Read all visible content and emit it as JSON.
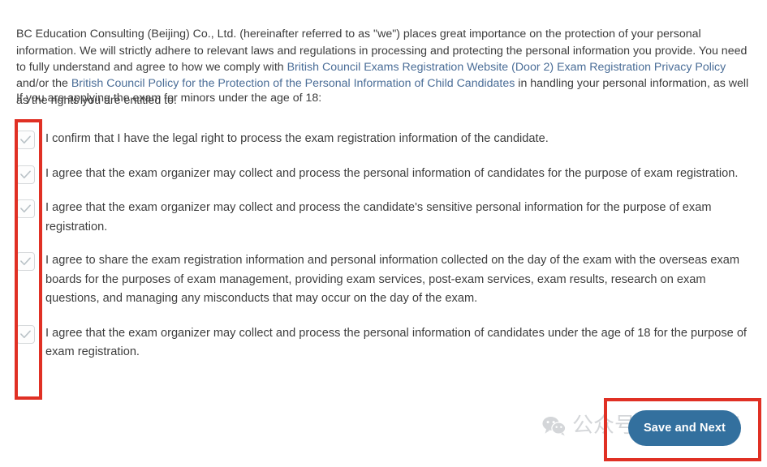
{
  "intro": {
    "part1": "BC Education Consulting (Beijing) Co., Ltd. (hereinafter referred to as \"we\") places great importance on the protection of your personal information. We will strictly adhere to relevant laws and regulations in processing and protecting the personal information you provide. You need to fully understand and agree to how we comply with ",
    "link1": "British Council Exams Registration Website (Door 2) Exam Registration Privacy Policy",
    "part2": " and/or the ",
    "link2": "British Council Policy for the Protection of the Personal Information of Child Candidates",
    "part3": " in handling your personal information, as well as the rights you are entitled to."
  },
  "minors_notice": "If you are applying the exam for minors under the age of 18:",
  "consents": [
    {
      "checked": true,
      "text": "I confirm that I have the legal right to process the exam registration information of the candidate."
    },
    {
      "checked": true,
      "text": "I agree that the exam organizer may collect and process the personal information of candidates for the purpose of exam registration."
    },
    {
      "checked": true,
      "text": "I agree that the exam organizer may collect and process the candidate's sensitive personal information for the purpose of exam registration."
    },
    {
      "checked": true,
      "text": "I agree to share the exam registration information and personal information collected on the day of the exam with the overseas exam boards for the purposes of exam management, providing exam services, post-exam services, exam results, research on exam questions, and managing any misconducts that may occur on the day of the exam."
    },
    {
      "checked": true,
      "text": "I agree that the exam organizer may collect and process the personal information of candidates under the age of 18 for the purpose of exam registration."
    }
  ],
  "save_button": {
    "label": "Save and Next"
  },
  "watermark": {
    "text": "公众号 · 剑藤教育",
    "icon": "wechat-icon"
  },
  "annotations": {
    "checkbox_group": "red-highlight-box",
    "save_button": "red-highlight-box"
  },
  "colors": {
    "link": "#4a6d97",
    "button_blue": "#33709e",
    "annotation_red": "#e03024",
    "text": "#3d3d3d",
    "checkbox_border": "#d6d9db",
    "checkmark": "#b9c2c7"
  }
}
